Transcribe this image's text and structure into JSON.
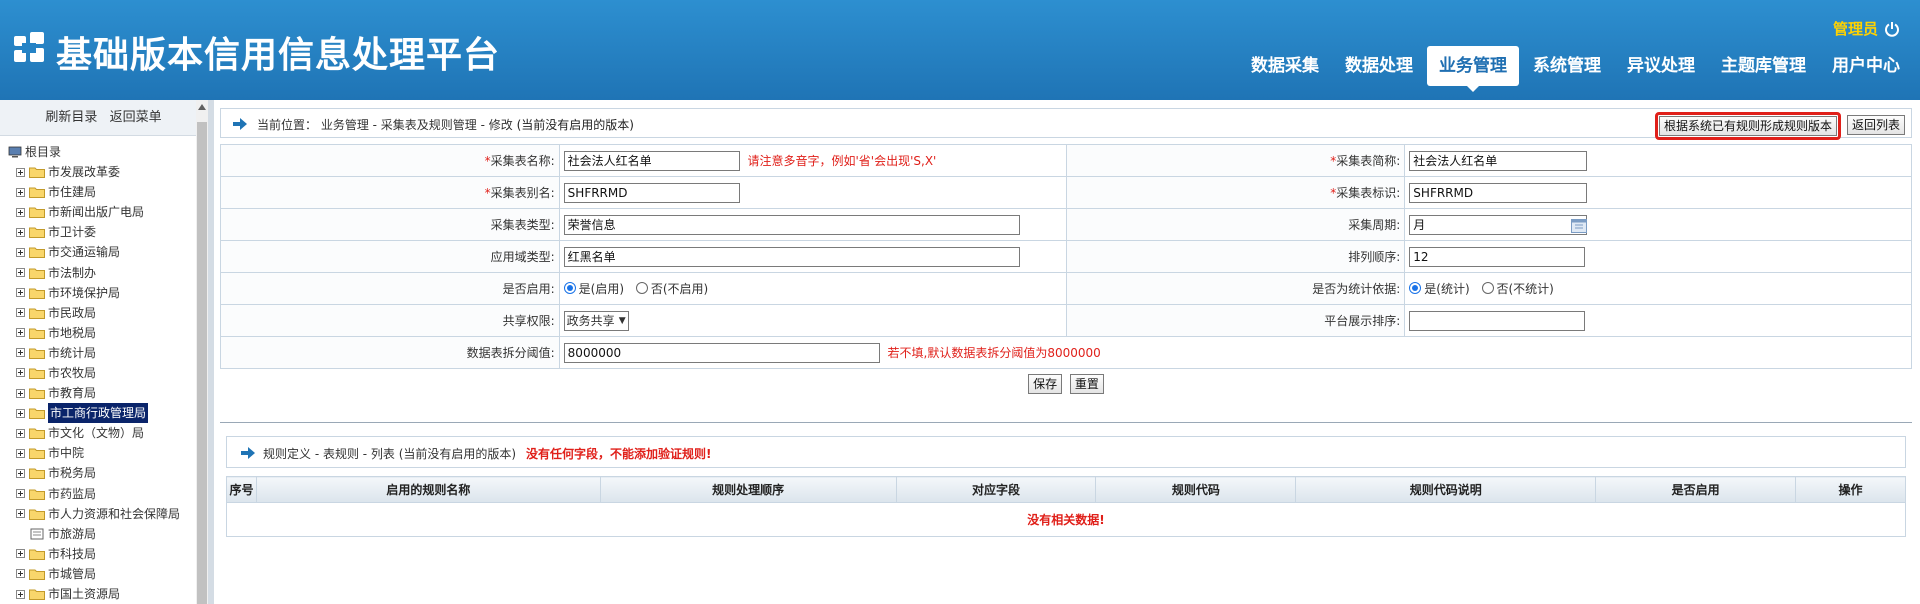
{
  "app": {
    "title": "基础版本信用信息处理平台"
  },
  "user": {
    "name": "管理员"
  },
  "nav": [
    {
      "label": "数据采集",
      "active": false
    },
    {
      "label": "数据处理",
      "active": false
    },
    {
      "label": "业务管理",
      "active": true
    },
    {
      "label": "系统管理",
      "active": false
    },
    {
      "label": "异议处理",
      "active": false
    },
    {
      "label": "主题库管理",
      "active": false
    },
    {
      "label": "用户中心",
      "active": false
    }
  ],
  "sidebar": {
    "refresh": "刷新目录",
    "back": "返回菜单",
    "root": "根目录",
    "items": [
      "市发展改革委",
      "市住建局",
      "市新闻出版广电局",
      "市卫计委",
      "市交通运输局",
      "市法制办",
      "市环境保护局",
      "市民政局",
      "市地税局",
      "市统计局",
      "市农牧局",
      "市教育局",
      "市工商行政管理局",
      "市文化（文物）局",
      "市中院",
      "市税务局",
      "市药监局",
      "市人力资源和社会保障局",
      "市旅游局",
      "市科技局",
      "市城管局",
      "市国土资源局"
    ],
    "selected_index": 12
  },
  "breadcrumb": {
    "prefix": "当前位置：",
    "path": "业务管理 - 采集表及规则管理 - 修改",
    "note": "(当前没有启用的版本)"
  },
  "buttons": {
    "generate_rule_version": "根据系统已有规则形成规则版本",
    "back_to_list": "返回列表",
    "save": "保存",
    "reset": "重置"
  },
  "form": {
    "table_name": {
      "label": "采集表名称:",
      "value": "社会法人红名单",
      "hint": "请注意多音字，例如'省'会出现'S,X'"
    },
    "table_short": {
      "label": "采集表简称:",
      "value": "社会法人红名单"
    },
    "table_alias": {
      "label": "采集表别名:",
      "value": "SHFRRMD"
    },
    "table_id": {
      "label": "采集表标识:",
      "value": "SHFRRMD"
    },
    "table_type": {
      "label": "采集表类型:",
      "value": "荣誉信息"
    },
    "cycle": {
      "label": "采集周期:",
      "value": "月"
    },
    "domain_type": {
      "label": "应用域类型:",
      "value": "红黑名单"
    },
    "sort_order": {
      "label": "排列顺序:",
      "value": "12"
    },
    "enabled": {
      "label": "是否启用:",
      "opt_yes": "是(启用)",
      "opt_no": "否(不启用)",
      "value": "yes"
    },
    "stat_basis": {
      "label": "是否为统计依据:",
      "opt_yes": "是(统计)",
      "opt_no": "否(不统计)",
      "value": "yes"
    },
    "share": {
      "label": "共享权限:",
      "value": "政务共享"
    },
    "platform_order": {
      "label": "平台展示排序:",
      "value": ""
    },
    "split_threshold": {
      "label": "数据表拆分阈值:",
      "value": "8000000",
      "hint": "若不填,默认数据表拆分阈值为8000000"
    }
  },
  "rules": {
    "title": "规则定义 - 表规则 - 列表",
    "note": "(当前没有启用的版本)",
    "warning": "没有任何字段，不能添加验证规则!",
    "columns": [
      "序号",
      "启用的规则名称",
      "规则处理顺序",
      "对应字段",
      "规则代码",
      "规则代码说明",
      "是否启用",
      "操作"
    ],
    "empty": "没有相关数据!"
  },
  "colors": {
    "header": "#1f74b5",
    "accent_red": "#e0201a",
    "user_yellow": "#ffd200"
  }
}
